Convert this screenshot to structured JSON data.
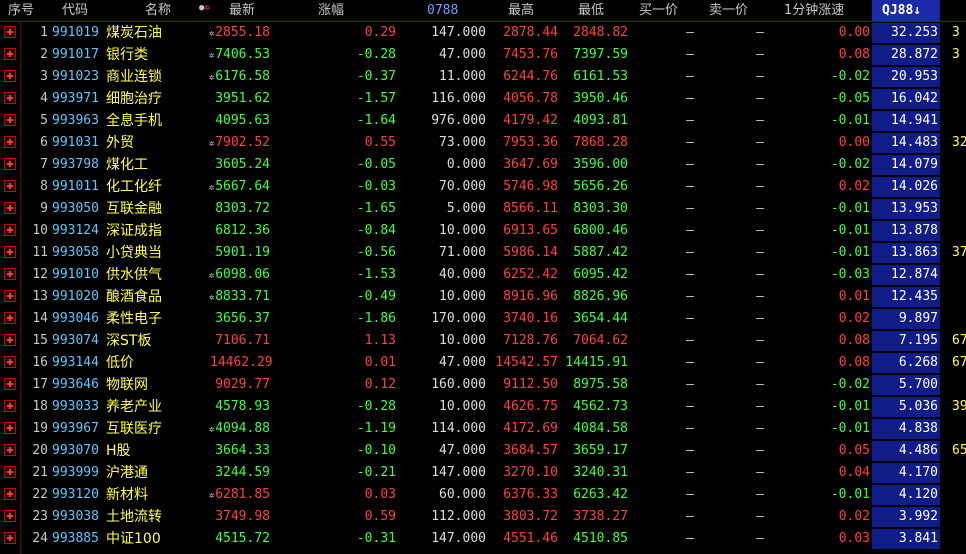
{
  "header": {
    "seq": "序号",
    "code": "代码",
    "name": "名称",
    "last": "最新",
    "chg": "涨幅",
    "vol": "0788",
    "high": "最高",
    "low": "最低",
    "bid": "买一价",
    "ask": "卖一价",
    "speed": "1分钟涨速",
    "sorted": "QJ88",
    "sort_arrow": "↓"
  },
  "colors": {
    "up": "#ff4040",
    "down": "#40ff40",
    "code": "#5cc8ff",
    "name": "#ffff50",
    "sorted_column_bg": "#101c88"
  },
  "rows": [
    {
      "seq": "1",
      "code": "991019",
      "name": "煤炭石油",
      "flag": true,
      "last": "2855.18",
      "chg": "0.29",
      "vol": "147.000",
      "high": "2878.44",
      "low": "2848.82",
      "bid": "—",
      "ask": "—",
      "speed": "0.00",
      "qj": "32.253",
      "extra": "3",
      "dir_last": "up",
      "dir_chg": "up",
      "dir_high": "up",
      "dir_low": "up",
      "dir_spd": "up"
    },
    {
      "seq": "2",
      "code": "991017",
      "name": "银行类",
      "flag": true,
      "last": "7406.53",
      "chg": "-0.28",
      "vol": "47.000",
      "high": "7453.76",
      "low": "7397.59",
      "bid": "—",
      "ask": "—",
      "speed": "0.08",
      "qj": "28.872",
      "extra": "3",
      "dir_last": "dn",
      "dir_chg": "dn",
      "dir_high": "up",
      "dir_low": "dn",
      "dir_spd": "up"
    },
    {
      "seq": "3",
      "code": "991023",
      "name": "商业连锁",
      "flag": true,
      "last": "6176.58",
      "chg": "-0.37",
      "vol": "11.000",
      "high": "6244.76",
      "low": "6161.53",
      "bid": "—",
      "ask": "—",
      "speed": "-0.02",
      "qj": "20.953",
      "extra": "",
      "dir_last": "dn",
      "dir_chg": "dn",
      "dir_high": "up",
      "dir_low": "dn",
      "dir_spd": "dn"
    },
    {
      "seq": "4",
      "code": "993971",
      "name": "细胞治疗",
      "flag": false,
      "last": "3951.62",
      "chg": "-1.57",
      "vol": "116.000",
      "high": "4056.78",
      "low": "3950.46",
      "bid": "—",
      "ask": "—",
      "speed": "-0.05",
      "qj": "16.042",
      "extra": "",
      "dir_last": "dn",
      "dir_chg": "dn",
      "dir_high": "up",
      "dir_low": "dn",
      "dir_spd": "dn"
    },
    {
      "seq": "5",
      "code": "993963",
      "name": "全息手机",
      "flag": false,
      "last": "4095.63",
      "chg": "-1.64",
      "vol": "976.000",
      "high": "4179.42",
      "low": "4093.81",
      "bid": "—",
      "ask": "—",
      "speed": "-0.01",
      "qj": "14.941",
      "extra": "",
      "dir_last": "dn",
      "dir_chg": "dn",
      "dir_high": "up",
      "dir_low": "dn",
      "dir_spd": "dn"
    },
    {
      "seq": "6",
      "code": "991031",
      "name": "外贸",
      "flag": true,
      "last": "7902.52",
      "chg": "0.55",
      "vol": "73.000",
      "high": "7953.36",
      "low": "7868.28",
      "bid": "—",
      "ask": "—",
      "speed": "0.00",
      "qj": "14.483",
      "extra": "32",
      "dir_last": "up",
      "dir_chg": "up",
      "dir_high": "up",
      "dir_low": "up",
      "dir_spd": "up"
    },
    {
      "seq": "7",
      "code": "993798",
      "name": "煤化工",
      "flag": false,
      "last": "3605.24",
      "chg": "-0.05",
      "vol": "0.000",
      "high": "3647.69",
      "low": "3596.00",
      "bid": "—",
      "ask": "—",
      "speed": "-0.02",
      "qj": "14.079",
      "extra": "",
      "dir_last": "dn",
      "dir_chg": "dn",
      "dir_high": "up",
      "dir_low": "dn",
      "dir_spd": "dn"
    },
    {
      "seq": "8",
      "code": "991011",
      "name": "化工化纤",
      "flag": true,
      "last": "5667.64",
      "chg": "-0.03",
      "vol": "70.000",
      "high": "5746.98",
      "low": "5656.26",
      "bid": "—",
      "ask": "—",
      "speed": "0.02",
      "qj": "14.026",
      "extra": "",
      "dir_last": "dn",
      "dir_chg": "dn",
      "dir_high": "up",
      "dir_low": "dn",
      "dir_spd": "up"
    },
    {
      "seq": "9",
      "code": "993050",
      "name": "互联金融",
      "flag": false,
      "last": "8303.72",
      "chg": "-1.65",
      "vol": "5.000",
      "high": "8566.11",
      "low": "8303.30",
      "bid": "—",
      "ask": "—",
      "speed": "-0.01",
      "qj": "13.953",
      "extra": "",
      "dir_last": "dn",
      "dir_chg": "dn",
      "dir_high": "up",
      "dir_low": "dn",
      "dir_spd": "dn"
    },
    {
      "seq": "10",
      "code": "993124",
      "name": "深证成指",
      "flag": false,
      "last": "6812.36",
      "chg": "-0.84",
      "vol": "10.000",
      "high": "6913.65",
      "low": "6800.46",
      "bid": "—",
      "ask": "—",
      "speed": "-0.01",
      "qj": "13.878",
      "extra": "",
      "dir_last": "dn",
      "dir_chg": "dn",
      "dir_high": "up",
      "dir_low": "dn",
      "dir_spd": "dn"
    },
    {
      "seq": "11",
      "code": "993058",
      "name": "小贷典当",
      "flag": false,
      "last": "5901.19",
      "chg": "-0.56",
      "vol": "71.000",
      "high": "5986.14",
      "low": "5887.42",
      "bid": "—",
      "ask": "—",
      "speed": "-0.01",
      "qj": "13.863",
      "extra": "37",
      "dir_last": "dn",
      "dir_chg": "dn",
      "dir_high": "up",
      "dir_low": "dn",
      "dir_spd": "dn"
    },
    {
      "seq": "12",
      "code": "991010",
      "name": "供水供气",
      "flag": true,
      "last": "6098.06",
      "chg": "-1.53",
      "vol": "40.000",
      "high": "6252.42",
      "low": "6095.42",
      "bid": "—",
      "ask": "—",
      "speed": "-0.03",
      "qj": "12.874",
      "extra": "",
      "dir_last": "dn",
      "dir_chg": "dn",
      "dir_high": "up",
      "dir_low": "dn",
      "dir_spd": "dn"
    },
    {
      "seq": "13",
      "code": "991020",
      "name": "酿酒食品",
      "flag": true,
      "last": "8833.71",
      "chg": "-0.49",
      "vol": "10.000",
      "high": "8916.96",
      "low": "8826.96",
      "bid": "—",
      "ask": "—",
      "speed": "0.01",
      "qj": "12.435",
      "extra": "",
      "dir_last": "dn",
      "dir_chg": "dn",
      "dir_high": "up",
      "dir_low": "dn",
      "dir_spd": "up"
    },
    {
      "seq": "14",
      "code": "993046",
      "name": "柔性电子",
      "flag": false,
      "last": "3656.37",
      "chg": "-1.86",
      "vol": "170.000",
      "high": "3740.16",
      "low": "3654.44",
      "bid": "—",
      "ask": "—",
      "speed": "0.02",
      "qj": "9.897",
      "extra": "",
      "dir_last": "dn",
      "dir_chg": "dn",
      "dir_high": "up",
      "dir_low": "dn",
      "dir_spd": "up"
    },
    {
      "seq": "15",
      "code": "993074",
      "name": "深ST板",
      "flag": false,
      "last": "7106.71",
      "chg": "1.13",
      "vol": "10.000",
      "high": "7128.76",
      "low": "7064.62",
      "bid": "—",
      "ask": "—",
      "speed": "0.08",
      "qj": "7.195",
      "extra": "67",
      "dir_last": "up",
      "dir_chg": "up",
      "dir_high": "up",
      "dir_low": "up",
      "dir_spd": "up"
    },
    {
      "seq": "16",
      "code": "993144",
      "name": "低价",
      "flag": false,
      "last": "14462.29",
      "chg": "0.01",
      "vol": "47.000",
      "high": "14542.57",
      "low": "14415.91",
      "bid": "—",
      "ask": "—",
      "speed": "0.08",
      "qj": "6.268",
      "extra": "67",
      "dir_last": "up",
      "dir_chg": "up",
      "dir_high": "up",
      "dir_low": "dn",
      "dir_spd": "up"
    },
    {
      "seq": "17",
      "code": "993646",
      "name": "物联网",
      "flag": false,
      "last": "9029.77",
      "chg": "0.12",
      "vol": "160.000",
      "high": "9112.50",
      "low": "8975.58",
      "bid": "—",
      "ask": "—",
      "speed": "-0.02",
      "qj": "5.700",
      "extra": "",
      "dir_last": "up",
      "dir_chg": "up",
      "dir_high": "up",
      "dir_low": "dn",
      "dir_spd": "dn"
    },
    {
      "seq": "18",
      "code": "993033",
      "name": "养老产业",
      "flag": false,
      "last": "4578.93",
      "chg": "-0.28",
      "vol": "10.000",
      "high": "4626.75",
      "low": "4562.73",
      "bid": "—",
      "ask": "—",
      "speed": "-0.01",
      "qj": "5.036",
      "extra": "39",
      "dir_last": "dn",
      "dir_chg": "dn",
      "dir_high": "up",
      "dir_low": "dn",
      "dir_spd": "dn"
    },
    {
      "seq": "19",
      "code": "993967",
      "name": "互联医疗",
      "flag": true,
      "last": "4094.88",
      "chg": "-1.19",
      "vol": "114.000",
      "high": "4172.69",
      "low": "4084.58",
      "bid": "—",
      "ask": "—",
      "speed": "-0.01",
      "qj": "4.838",
      "extra": "",
      "dir_last": "dn",
      "dir_chg": "dn",
      "dir_high": "up",
      "dir_low": "dn",
      "dir_spd": "dn"
    },
    {
      "seq": "20",
      "code": "993070",
      "name": "H股",
      "flag": false,
      "last": "3664.33",
      "chg": "-0.10",
      "vol": "47.000",
      "high": "3684.57",
      "low": "3659.17",
      "bid": "—",
      "ask": "—",
      "speed": "0.05",
      "qj": "4.486",
      "extra": "65",
      "dir_last": "dn",
      "dir_chg": "dn",
      "dir_high": "up",
      "dir_low": "dn",
      "dir_spd": "up"
    },
    {
      "seq": "21",
      "code": "993999",
      "name": "沪港通",
      "flag": false,
      "last": "3244.59",
      "chg": "-0.21",
      "vol": "147.000",
      "high": "3270.10",
      "low": "3240.31",
      "bid": "—",
      "ask": "—",
      "speed": "0.04",
      "qj": "4.170",
      "extra": "",
      "dir_last": "dn",
      "dir_chg": "dn",
      "dir_high": "up",
      "dir_low": "dn",
      "dir_spd": "up"
    },
    {
      "seq": "22",
      "code": "993120",
      "name": "新材料",
      "flag": true,
      "last": "6281.85",
      "chg": "0.03",
      "vol": "60.000",
      "high": "6376.33",
      "low": "6263.42",
      "bid": "—",
      "ask": "—",
      "speed": "-0.01",
      "qj": "4.120",
      "extra": "",
      "dir_last": "up",
      "dir_chg": "up",
      "dir_high": "up",
      "dir_low": "dn",
      "dir_spd": "dn"
    },
    {
      "seq": "23",
      "code": "993038",
      "name": "土地流转",
      "flag": false,
      "last": "3749.98",
      "chg": "0.59",
      "vol": "112.000",
      "high": "3803.72",
      "low": "3738.27",
      "bid": "—",
      "ask": "—",
      "speed": "0.02",
      "qj": "3.992",
      "extra": "",
      "dir_last": "up",
      "dir_chg": "up",
      "dir_high": "up",
      "dir_low": "up",
      "dir_spd": "up"
    },
    {
      "seq": "24",
      "code": "993885",
      "name": "中证100",
      "flag": false,
      "last": "4515.72",
      "chg": "-0.31",
      "vol": "147.000",
      "high": "4551.46",
      "low": "4510.85",
      "bid": "—",
      "ask": "—",
      "speed": "0.03",
      "qj": "3.841",
      "extra": "",
      "dir_last": "dn",
      "dir_chg": "dn",
      "dir_high": "up",
      "dir_low": "dn",
      "dir_spd": "up"
    }
  ]
}
